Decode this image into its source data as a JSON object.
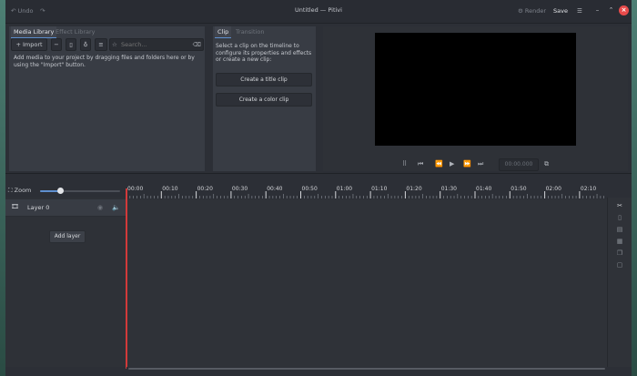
{
  "window": {
    "title": "Untitled — Pitivi",
    "undo_label": "Undo",
    "render_label": "Render",
    "save_label": "Save"
  },
  "media_library": {
    "tabs": [
      "Media Library",
      "Effect Library"
    ],
    "import_label": "Import",
    "search": {
      "placeholder": "Search..."
    },
    "empty_text": "Add media to your project by dragging files and folders here or by using the \"Import\" button."
  },
  "clip_panel": {
    "tabs": [
      "Clip",
      "Transition"
    ],
    "hint_text": "Select a clip on the timeline to configure its properties and effects or create a new clip:",
    "create_title_label": "Create a title clip",
    "create_color_label": "Create a color clip"
  },
  "viewer": {
    "timecode": "00:00.000"
  },
  "timeline": {
    "zoom_label": "Zoom",
    "zoom_level": 0.25,
    "ruler_labels": [
      "00:00",
      "00:10",
      "00:20",
      "00:30",
      "00:40",
      "00:50",
      "01:00",
      "01:10",
      "01:20",
      "01:30",
      "01:40",
      "01:50",
      "02:00",
      "02:10"
    ],
    "layer_name": "Layer 0",
    "add_layer_label": "Add layer"
  },
  "colors": {
    "accent": "#5e8fcf",
    "playhead": "#d23a3a",
    "close_button": "#e84b4b",
    "panel_bg": "#383c44",
    "window_bg": "#2c2f36"
  }
}
